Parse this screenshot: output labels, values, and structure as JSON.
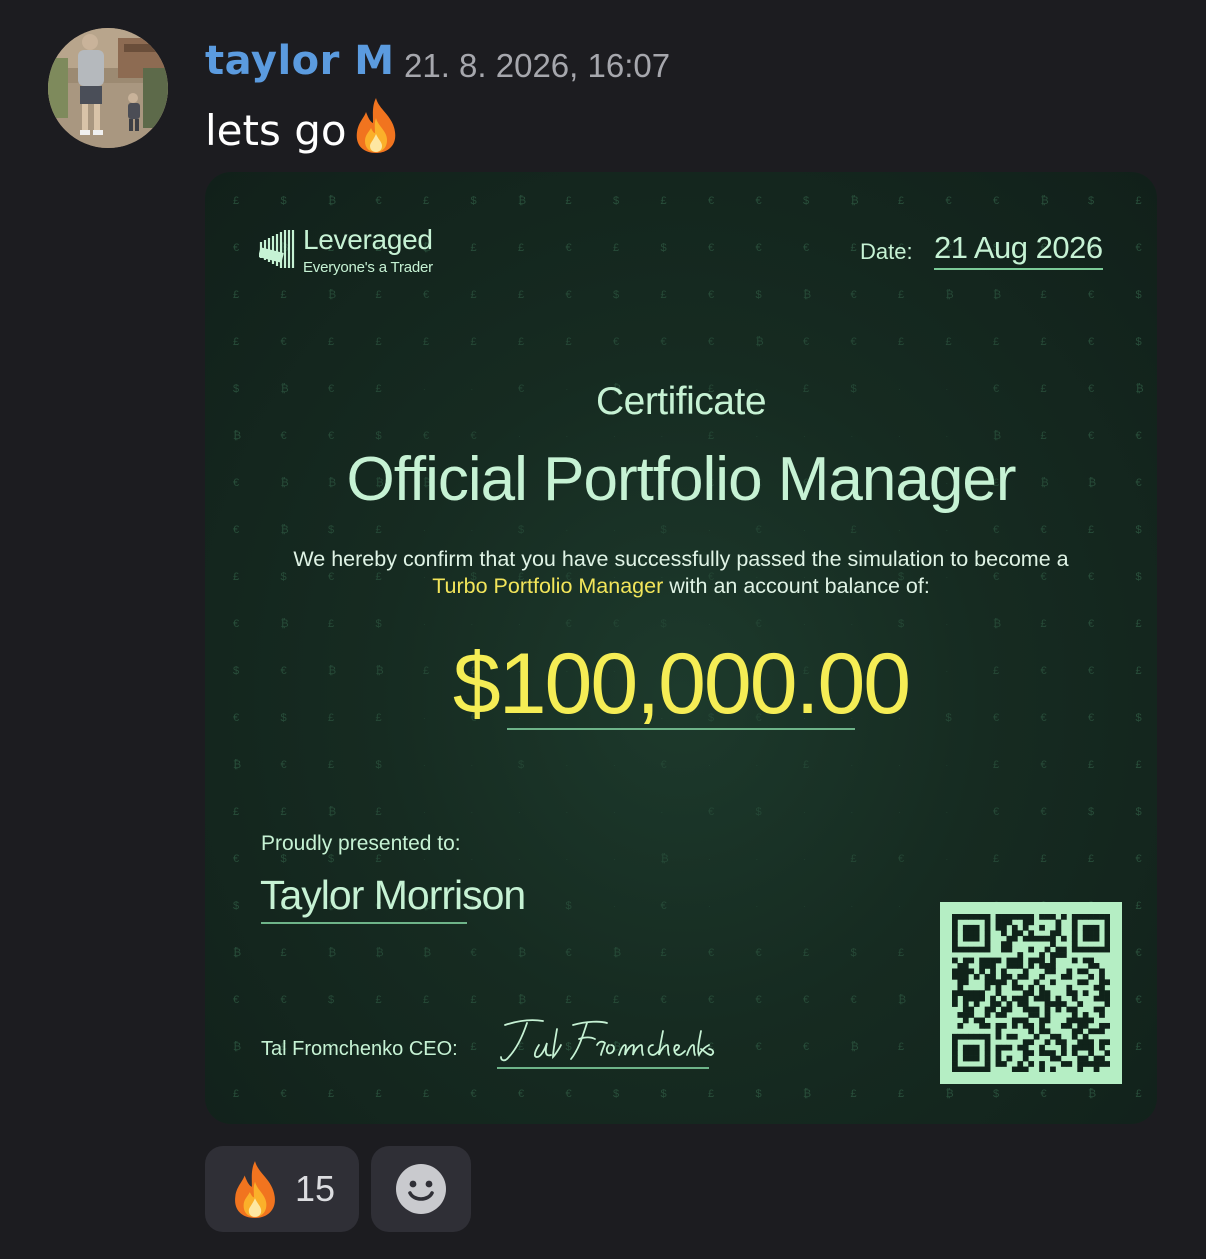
{
  "message": {
    "author": "taylor M",
    "timestamp": "21. 8. 2026, 16:07",
    "text": "lets go",
    "text_emoji": "fire-emoji",
    "avatar_icon": "user-avatar-photo"
  },
  "certificate": {
    "brand_name": "Leveraged",
    "brand_tagline": "Everyone's a Trader",
    "date_label": "Date:",
    "date_value": "21 Aug 2026",
    "heading": "Certificate",
    "title": "Official Portfolio Manager",
    "body_prefix": "We hereby confirm that you have successfully passed the simulation to become a",
    "body_highlight": "Turbo Portfolio Manager",
    "body_suffix": "with an account balance of:",
    "amount": "$100,000.00",
    "presented_label": "Proudly presented to:",
    "recipient": "Taylor Morrison",
    "ceo_label": "Tal Fromchenko CEO:",
    "signature": "Tal Fromchenko",
    "qr_icon": "qr-code",
    "colors": {
      "background": "#162b21",
      "mint": "#c6f2d4",
      "highlight": "#f2e55a",
      "qr_background": "#b5eec4"
    }
  },
  "reactions": [
    {
      "emoji": "fire-emoji",
      "count": "15"
    },
    {
      "emoji": "add-reaction-icon"
    }
  ],
  "colors": {
    "app_background": "#1c1c20",
    "username": "#5b9bdf",
    "timestamp": "#a6a7ad",
    "reaction_background": "#2f2f36"
  }
}
